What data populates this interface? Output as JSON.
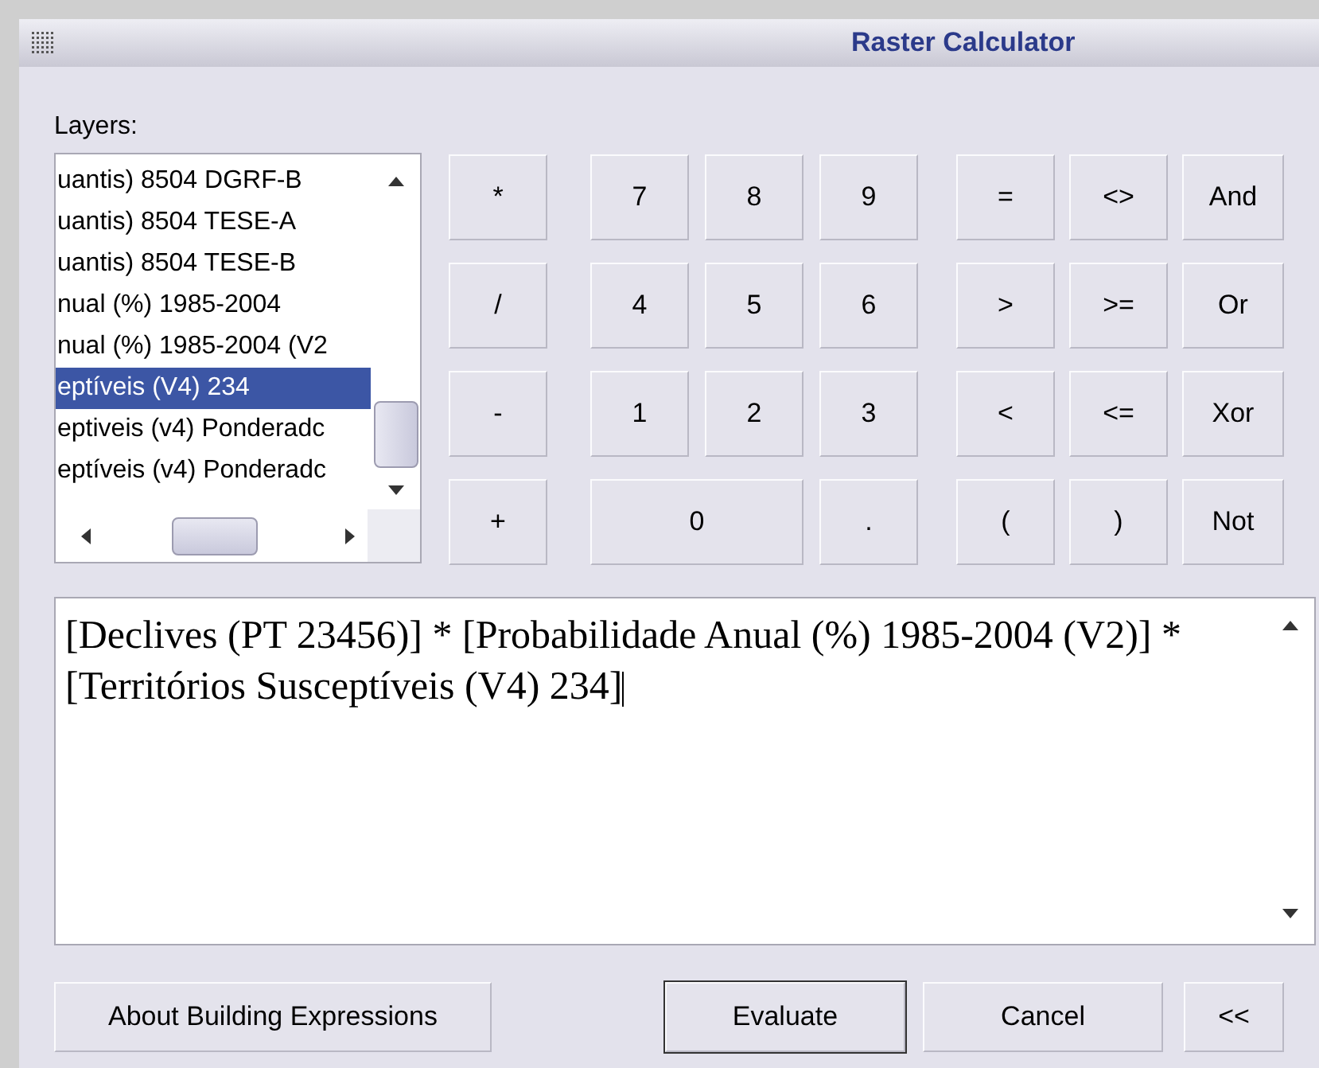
{
  "window": {
    "title": "Raster Calculator"
  },
  "layers": {
    "label": "Layers:",
    "items": [
      {
        "label": "uantis) 8504 DGRF-B",
        "selected": false
      },
      {
        "label": "uantis) 8504 TESE-A",
        "selected": false
      },
      {
        "label": "uantis) 8504 TESE-B",
        "selected": false
      },
      {
        "label": "nual (%) 1985-2004",
        "selected": false
      },
      {
        "label": "nual (%) 1985-2004 (V2",
        "selected": false
      },
      {
        "label": "eptíveis (V4) 234",
        "selected": true
      },
      {
        "label": "eptiveis (v4) Ponderadc",
        "selected": false
      },
      {
        "label": "eptíveis (v4) Ponderadc",
        "selected": false
      }
    ]
  },
  "keypad": {
    "operators": [
      "*",
      "/",
      "-",
      "+"
    ],
    "digits": [
      [
        "7",
        "8",
        "9"
      ],
      [
        "4",
        "5",
        "6"
      ],
      [
        "1",
        "2",
        "3"
      ],
      [
        "0",
        "."
      ]
    ],
    "comparisons": [
      [
        "=",
        "<>",
        "And"
      ],
      [
        ">",
        ">=",
        "Or"
      ],
      [
        "<",
        "<=",
        "Xor"
      ],
      [
        "(",
        ")",
        "Not"
      ]
    ]
  },
  "expression": "[Declives (PT 23456)] * [Probabilidade Anual (%) 1985-2004 (V2)] * [Territórios Susceptíveis (V4) 234]",
  "buttons": [
    {
      "label": "About Building Expressions",
      "kind": "plain"
    },
    {
      "label": "Evaluate",
      "kind": "default"
    },
    {
      "label": "Cancel",
      "kind": "plain"
    },
    {
      "label": "<<",
      "kind": "plain"
    }
  ]
}
